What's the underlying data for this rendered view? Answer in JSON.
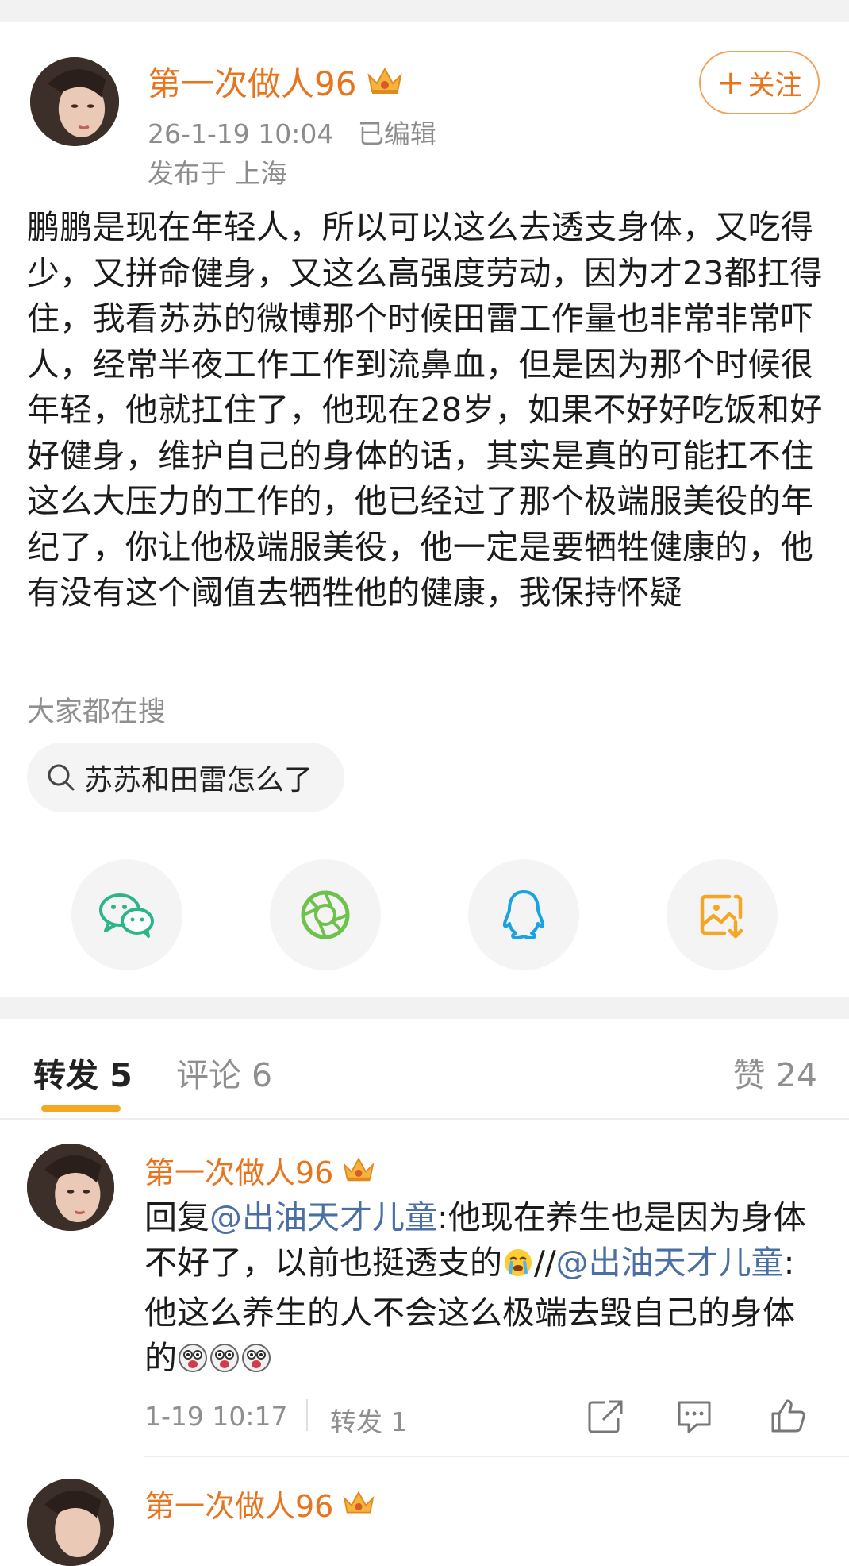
{
  "post": {
    "username": "第一次做人96",
    "timestamp": "26-1-19 10:04",
    "edited": "已编辑",
    "location": "发布于 上海",
    "follow_label": "关注",
    "text": "鹏鹏是现在年轻人，所以可以这么去透支身体，又吃得少，又拼命健身，又这么高强度劳动，因为才23都扛得住，我看苏苏的微博那个时候田雷工作量也非常非常吓人，经常半夜工作工作到流鼻血，但是因为那个时候很年轻，他就扛住了，他现在28岁，如果不好好吃饭和好好健身，维护自己的身体的话，其实是真的可能扛不住这么大压力的工作的，他已经过了那个极端服美役的年纪了，你让他极端服美役，他一定是要牺牲健康的，他有没有这个阈值去牺牲他的健康，我保持怀疑"
  },
  "search": {
    "label": "大家都在搜",
    "chip": "苏苏和田雷怎么了"
  },
  "share": {
    "icons": [
      "wechat-icon",
      "moments-icon",
      "qq-icon",
      "save-image-icon"
    ]
  },
  "tabs": {
    "repost": "转发 5",
    "comment": "评论 6",
    "like": "赞 24"
  },
  "comments": [
    {
      "username": "第一次做人96",
      "reply_prefix": "回复",
      "mention1": "@出油天才儿童",
      "text1": ":他现在养生也是因为身体不好了，以前也挺透支的",
      "sep": "//",
      "mention2": "@出油天才儿童",
      "text2": ":他这么养生的人不会这么极端去毁自己的身体的",
      "time": "1-19 10:17",
      "repost": "转发 1"
    },
    {
      "username": "第一次做人96"
    }
  ],
  "colors": {
    "accent": "#e8741e",
    "mention": "#4a6fa5",
    "tab_underline": "#f5a623"
  }
}
